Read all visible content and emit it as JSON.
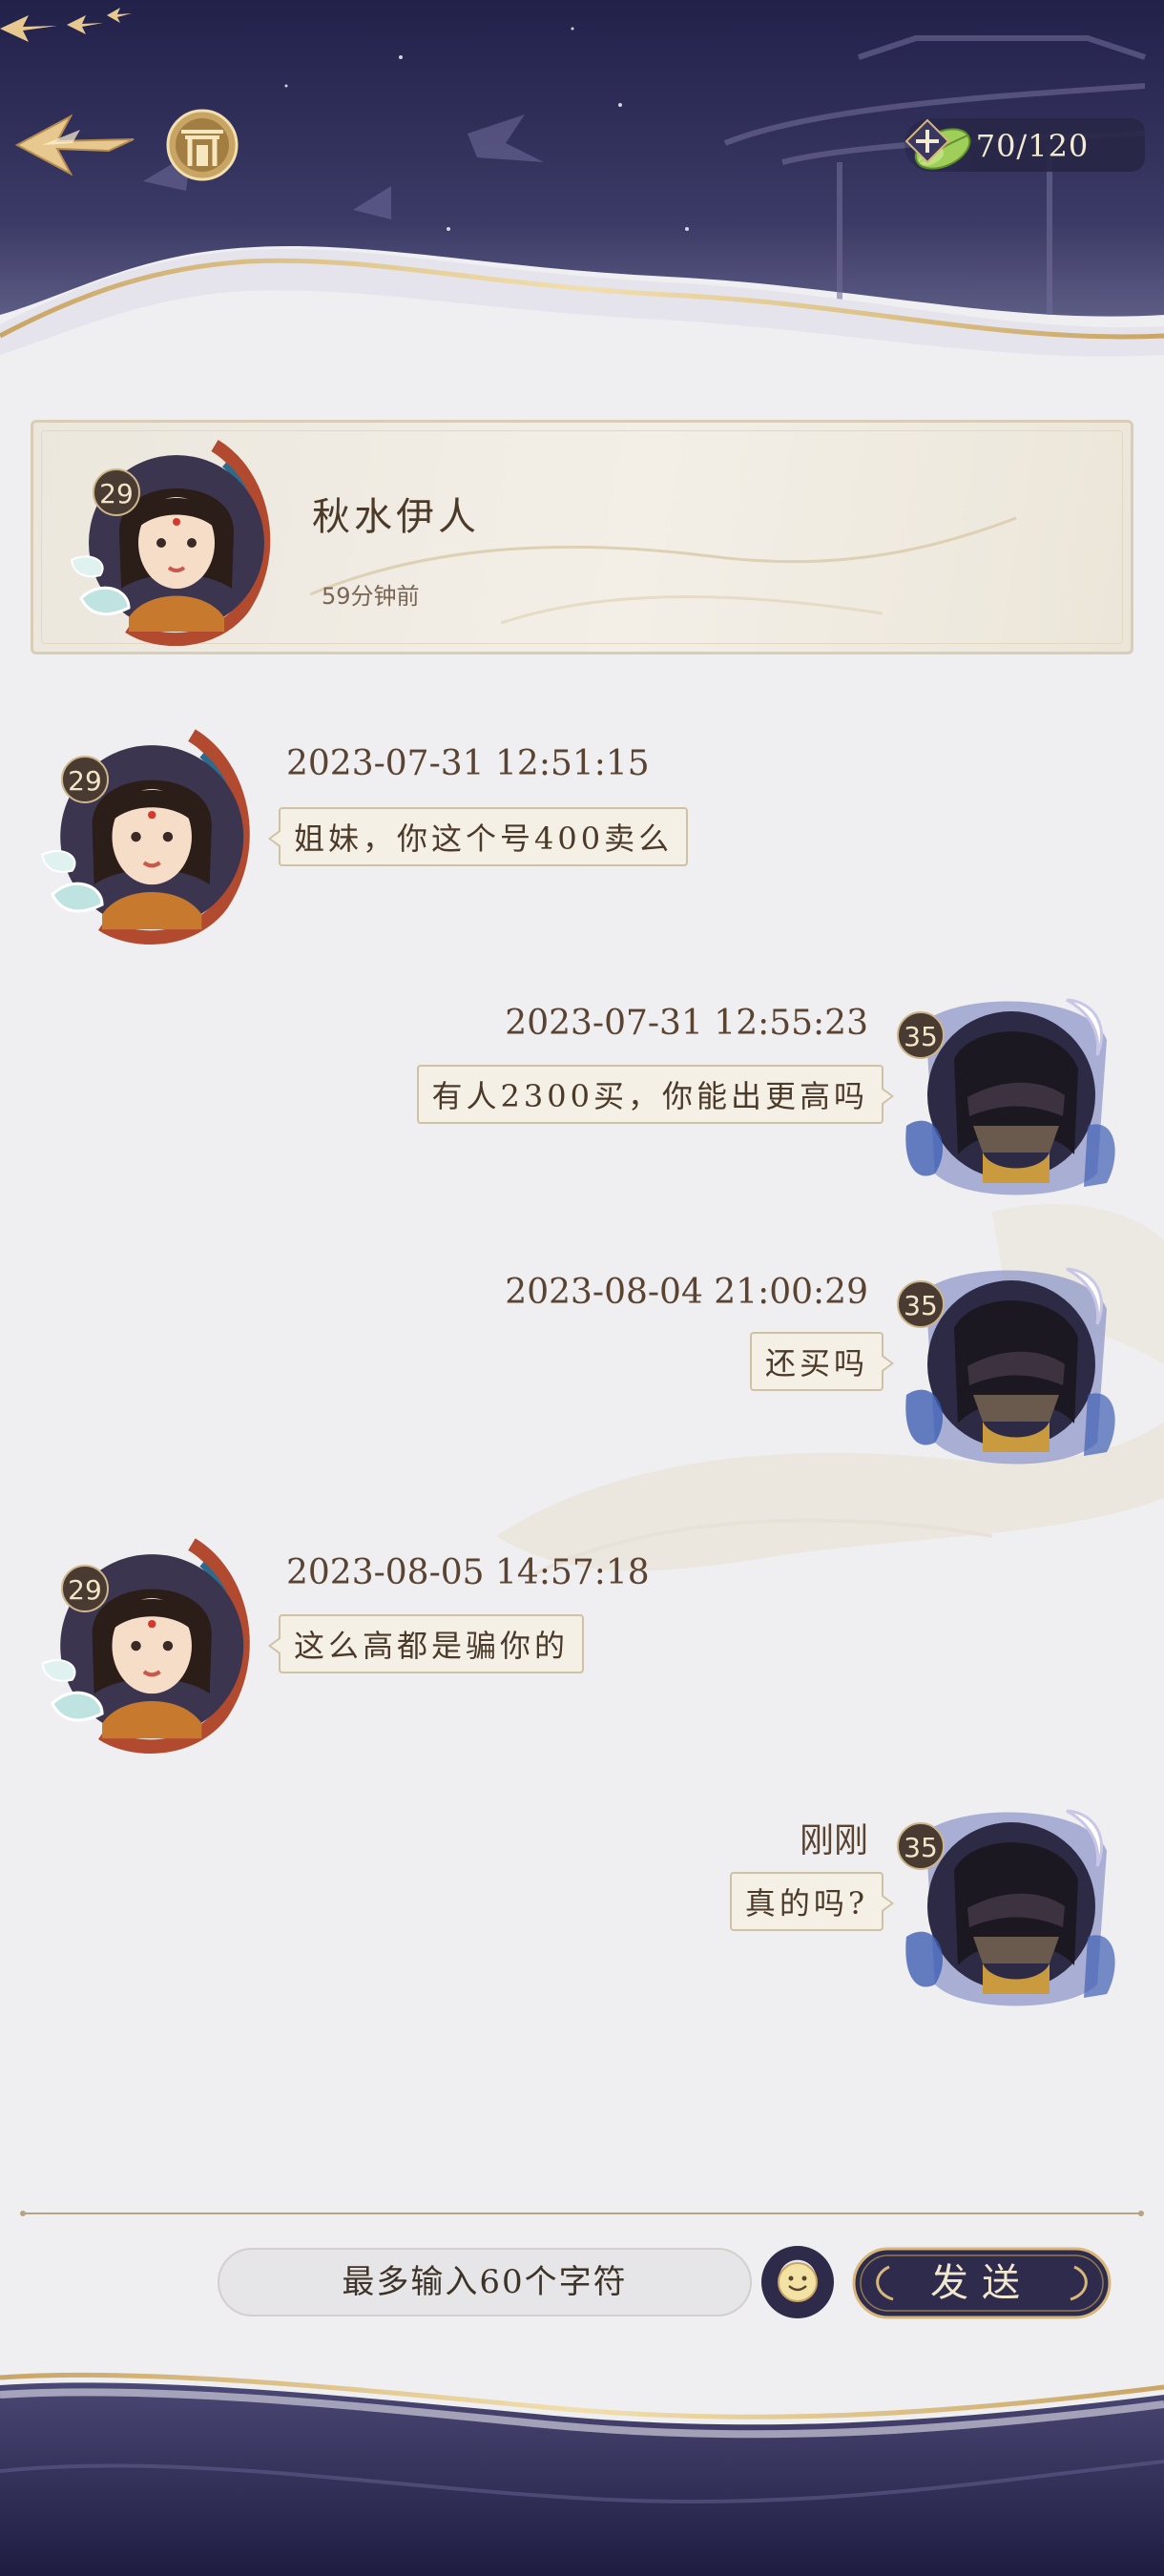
{
  "header": {
    "stamina": "70/120"
  },
  "profile": {
    "name": "秋水伊人",
    "last_seen": "59分钟前",
    "level": "29"
  },
  "messages": [
    {
      "side": "left",
      "time": "2023-07-31 12:51:15",
      "text": "姐妹，你这个号400卖么",
      "level": "29"
    },
    {
      "side": "right",
      "time": "2023-07-31 12:55:23",
      "text": "有人2300买，你能出更高吗",
      "level": "35"
    },
    {
      "side": "right",
      "time": "2023-08-04 21:00:29",
      "text": "还买吗",
      "level": "35"
    },
    {
      "side": "left",
      "time": "2023-08-05 14:57:18",
      "text": "这么高都是骗你的",
      "level": "29"
    },
    {
      "side": "right",
      "time": "刚刚",
      "text": "真的吗?",
      "level": "35"
    }
  ],
  "input": {
    "placeholder": "最多输入60个字符",
    "send_label": "发送"
  },
  "icons": {
    "back": "back-arrow-icon",
    "home": "home-gate-icon",
    "stamina": "leaf-icon",
    "add": "plus-icon",
    "emoji": "smiley-icon"
  },
  "colors": {
    "banner": "#2a2850",
    "gold": "#d8b77a",
    "bubble": "#f5f0e6",
    "text": "#4c3a29"
  }
}
